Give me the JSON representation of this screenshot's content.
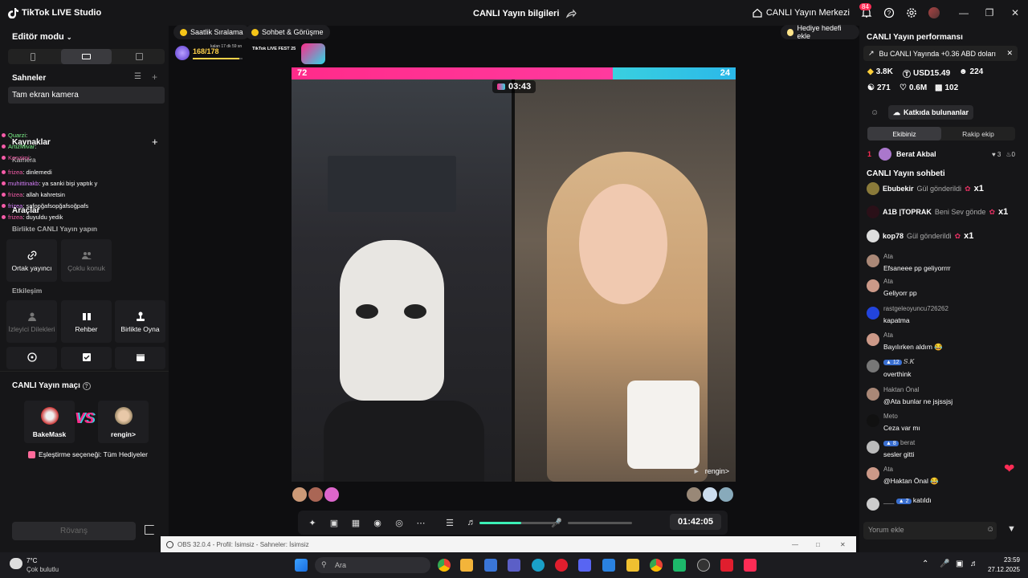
{
  "app": {
    "title": "TikTok LIVE Studio",
    "center_title": "CANLI Yayın bilgileri",
    "live_center": "CANLI Yayın Merkezi",
    "notif_count": "84"
  },
  "left": {
    "editor_mode": "Editör modu",
    "scenes_title": "Sahneler",
    "scene_item": "Tam ekran kamera",
    "sources_title": "Kaynaklar",
    "sources_sub": "Kamera",
    "tools_title": "Araçlar",
    "live_together": "Birlikte CANLI Yayın yapın",
    "cohost": "Ortak yayıncı",
    "multi_guest": "Çoklu konuk",
    "interaction": "Etkileşim",
    "viewer_wishes": "İzleyici Dilekleri",
    "guide": "Rehber",
    "play_together": "Birlikte Oyna",
    "overlay_chat": [
      {
        "name": "Quarzi",
        "text": ":"
      },
      {
        "name": "ArtizMivar",
        "text": ":"
      },
      {
        "name": "Kenzimi",
        "text": ":"
      },
      {
        "name": "frizea",
        "text": ": dinlemedi"
      },
      {
        "name": "muhittinakb",
        "text": ": ya sanki bişi yaptık y"
      },
      {
        "name": "frizea",
        "text": ": allah kahretsin"
      },
      {
        "name": "frizea",
        "text": ": safopğafsopğafsoğpafs"
      },
      {
        "name": "frizea",
        "text": ": duyuldu yedik"
      }
    ],
    "match_title": "CANLI Yayın maçı",
    "player_a": "BakeMask",
    "player_b": "rengin>",
    "vs": "VS",
    "pairing": "Eşleştirme seçeneği: Tüm Hediyeler",
    "rematch": "Rövanş"
  },
  "center": {
    "pill_ranking": "Saatlik Sıralama",
    "pill_chat": "Sohbet & Görüşme",
    "gift_goal": "Hediye hedefi ekle",
    "progress": "168/178",
    "progress_fraction": 0.94,
    "progress_sub": "kalan 17 dk 59 sn",
    "fest_tag": "TikTok LIVE FEST 25",
    "score_left": "72",
    "score_right": "24",
    "timer": "03:43",
    "host_right_name": "rengin>",
    "elapsed": "01:42:05",
    "volume_fraction": 0.52
  },
  "right": {
    "perf_title": "CANLI Yayın performansı",
    "perf_note": "Bu CANLI Yayında +0.36 ABD doları",
    "stats": {
      "diamonds": "3.8K",
      "usd": "USD15.49",
      "viewers": "224",
      "comments": "271",
      "likes": "0.6M",
      "gifts": "102"
    },
    "contributors": "Katkıda bulunanlar",
    "tab_team": "Ekibiniz",
    "tab_rival": "Rakip ekip",
    "rank_user": "Berat Akbal",
    "rank_num": "1",
    "rank_a": "3",
    "rank_b": "0",
    "chat_title": "CANLI Yayın sohbeti",
    "gifts": [
      {
        "user": "Ebubekir",
        "gift": "Gül gönderildi",
        "count": "x1"
      },
      {
        "user": "A1B |TOPRAK",
        "gift": "Beni Sev gönde",
        "count": "x1"
      },
      {
        "user": "kop78",
        "gift": "Gül gönderildi",
        "count": "x1"
      }
    ],
    "messages": [
      {
        "name": "Ata",
        "text": "Efsaneee pp geliyorrrr",
        "level": ""
      },
      {
        "name": "Ata",
        "text": "Geliyorr pp",
        "level": ""
      },
      {
        "name": "rastgeleoyuncu726262",
        "text": "kapatma",
        "level": ""
      },
      {
        "name": "Ata",
        "text": "Bayılırken aldım 😂",
        "level": ""
      },
      {
        "name": "𝑺.𝑲",
        "text": "overthink",
        "level": "12"
      },
      {
        "name": "Haktan Önal",
        "text": "@Ata bunlar ne jsjssjsj",
        "level": ""
      },
      {
        "name": "Meto",
        "text": "Ceza var mı",
        "level": ""
      },
      {
        "name": "berat",
        "text": "sesler gitti",
        "level": "8"
      },
      {
        "name": "Ata",
        "text": "@Haktan Önal 😂",
        "level": ""
      },
      {
        "name": "___",
        "text": "katıldı",
        "level": "2"
      }
    ],
    "comment_placeholder": "Yorum ekle"
  },
  "obs": {
    "title": "OBS 32.0.4 - Profil: İsimsiz - Sahneler: İsimsiz"
  },
  "taskbar": {
    "temp": "7°C",
    "weather": "Çok bulutlu",
    "search": "Ara",
    "time": "23:59",
    "date": "27.12.2025"
  }
}
